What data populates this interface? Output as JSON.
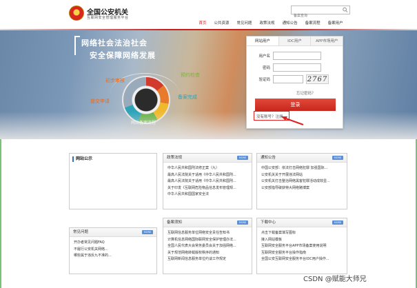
{
  "header": {
    "site_title": "全国公安机关",
    "site_subtitle": "互联网安全管理服务平台",
    "search_placeholder": "备案查询",
    "nav": [
      "首页",
      "公共资源",
      "常见问题",
      "政策法规",
      "通知公告",
      "备案流程",
      "备案用户"
    ]
  },
  "banner": {
    "slogan_line1": "网络社会法治社会",
    "slogan_line2": "安全保障网络发展",
    "flow_title": "网站备案流程",
    "steps": [
      "提交申请",
      "初步审核",
      "预约检查",
      "备案完成"
    ]
  },
  "login": {
    "tabs": [
      "网站用户",
      "IDC用户",
      "APP市场用户"
    ],
    "username_label": "用户名",
    "password_label": "密码",
    "captcha_label": "验证码",
    "captcha_code": "2767",
    "forgot": "忘记密码？",
    "submit": "登录",
    "register": "没有账号？注册"
  },
  "panels": {
    "side_notice": {
      "title": "网站公示"
    },
    "faq": {
      "title": "常见问题",
      "more": "MORE",
      "items": [
        "开办者常见问题FAQ",
        "不履行公安机关网络...",
        "哪些属于违反九不准的..."
      ]
    },
    "policy": {
      "title": "政策法规",
      "more": "MORE",
      "items": [
        "中华人民共和国刑法修正案（九）",
        "最高人民法院关于适用《中华人民共和国刑...",
        "最高人民法院关于适用《中华人民共和国刑...",
        "关于印发《互联网危险物品信息发布管理规...",
        "中华人民共和国国家安全法"
      ]
    },
    "notice": {
      "title": "通知公告",
      "more": "MORE",
      "items": [
        "中国公安部：依法打击网络犯罪 加强国际...",
        "公安机关关于开展违法网站",
        "公安机关打击整治网络黑客犯罪活动成效显...",
        "公安部指导破获特大网络赌博案"
      ]
    },
    "filing": {
      "title": "备案须知",
      "more": "MORE",
      "items": [
        "互联网信息服务单位网络安全责任告知书",
        "计算机信息网络国际联网安全保护管理办法...",
        "全国人民代表大会常务委员会关于加强网络...",
        "关于规范网络转载版权秩序的通知",
        "互联网新闻信息服务单位约谈工作规定"
      ]
    },
    "downloads": {
      "title": "下载中心",
      "more": "MORE",
      "items": [
        "点击下载备案填写图标",
        "接入网站模板",
        "互联网安全服务平台APP市场备案使用说明",
        "互联网安全服务平台操作指南",
        "全国公安互联网安全服务平台IDC用户操作..."
      ]
    }
  },
  "watermark": "CSDN @赋能大师兄"
}
